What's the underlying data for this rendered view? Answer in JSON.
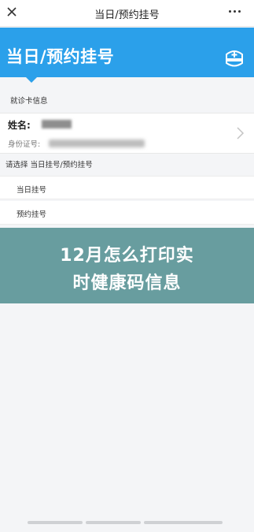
{
  "nav": {
    "title": "当日/预约挂号",
    "close_icon": "close-icon",
    "more_icon": "more-dots-icon"
  },
  "banner": {
    "title": "当日/预约挂号",
    "icon": "nurse-cap-icon",
    "color": "#2ba0ea"
  },
  "card_section": {
    "heading": "就诊卡信息",
    "name_label": "姓名:",
    "id_label": "身份证号:"
  },
  "select_section": {
    "heading": "请选择 当日挂号/预约挂号",
    "options": [
      {
        "label": "当日挂号"
      },
      {
        "label": "预约挂号"
      }
    ]
  },
  "overlay": {
    "line1": "12月怎么打印实",
    "line2": "时健康码信息",
    "color": "#5c9698"
  }
}
